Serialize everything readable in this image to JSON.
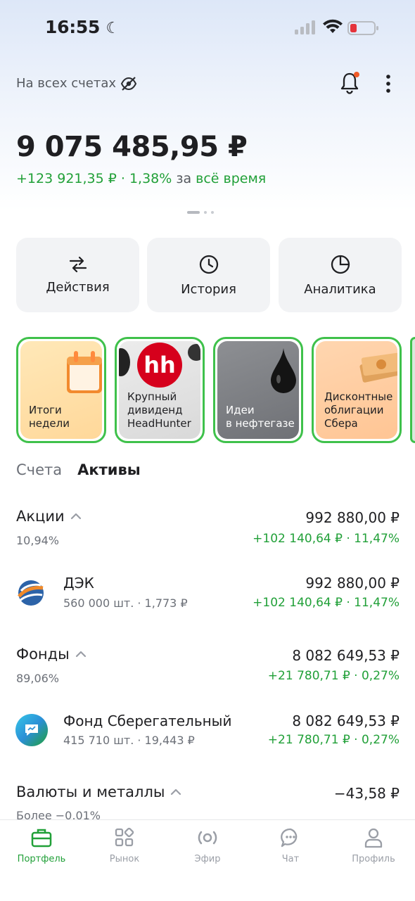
{
  "status_bar": {
    "time": "16:55"
  },
  "header": {
    "accounts_label": "На всех счетах"
  },
  "portfolio": {
    "balance": "9 075 485,95 ₽",
    "change_value": "+123 921,35 ₽ · 1,38%",
    "change_period_prefix": "за",
    "change_period": "всё время"
  },
  "actions": [
    {
      "label": "Действия",
      "icon": "arrows-swap-icon"
    },
    {
      "label": "История",
      "icon": "clock-icon"
    },
    {
      "label": "Аналитика",
      "icon": "pie-chart-icon"
    }
  ],
  "stories": [
    {
      "line1": "Итоги",
      "line2": "недели",
      "line3": ""
    },
    {
      "line1": "Крупный",
      "line2": "дивиденд",
      "line3": "HeadHunter",
      "logo_text": "hh"
    },
    {
      "line1": "Идеи",
      "line2": "в нефтегазе",
      "line3": ""
    },
    {
      "line1": "Дисконтные",
      "line2": "облигации",
      "line3": "Сбера"
    }
  ],
  "tabs": {
    "accounts": "Счета",
    "assets": "Активы"
  },
  "assets": {
    "stocks": {
      "title": "Акции",
      "share": "10,94%",
      "amount": "992 880,00 ₽",
      "gain": "+102 140,64 ₽ · 11,47%",
      "items": [
        {
          "name": "ДЭК",
          "details": "560 000 шт. · 1,773 ₽",
          "amount": "992 880,00 ₽",
          "gain": "+102 140,64 ₽ · 11,47%"
        }
      ]
    },
    "funds": {
      "title": "Фонды",
      "share": "89,06%",
      "amount": "8 082 649,53 ₽",
      "gain": "+21 780,71 ₽ · 0,27%",
      "items": [
        {
          "name": "Фонд Сберегательный",
          "details": "415 710 шт. · 19,443 ₽",
          "amount": "8 082 649,53 ₽",
          "gain": "+21 780,71 ₽ · 0,27%"
        }
      ]
    },
    "currencies": {
      "title": "Валюты и металлы",
      "share": "Более −0,01%",
      "amount": "−43,58 ₽"
    }
  },
  "bottom_nav": [
    {
      "label": "Портфель",
      "icon": "briefcase-icon",
      "active": true
    },
    {
      "label": "Рынок",
      "icon": "grid-icon",
      "active": false
    },
    {
      "label": "Эфир",
      "icon": "broadcast-icon",
      "active": false
    },
    {
      "label": "Чат",
      "icon": "chat-icon",
      "active": false
    },
    {
      "label": "Профиль",
      "icon": "profile-icon",
      "active": false
    }
  ],
  "colors": {
    "accent": "#21a038",
    "story_border": "#3fc14b",
    "card_bg": "#f2f3f5"
  }
}
